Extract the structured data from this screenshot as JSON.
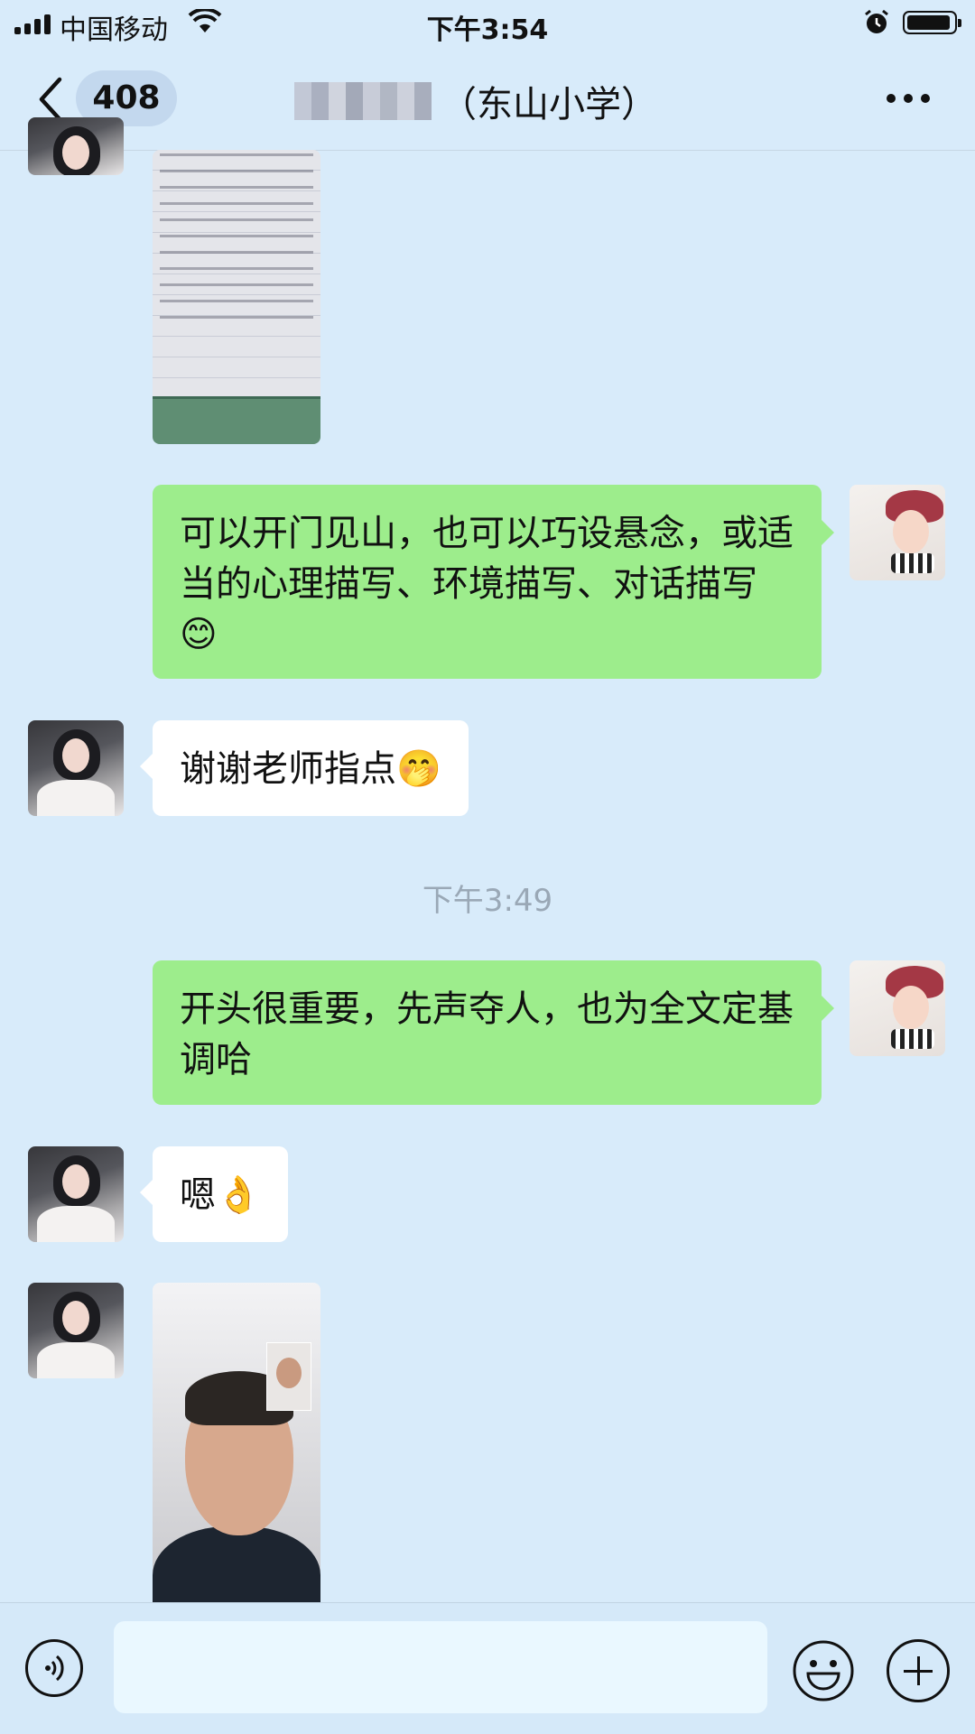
{
  "status_bar": {
    "carrier": "中国移动",
    "time": "下午3:54",
    "icons": [
      "signal-icon",
      "wifi-icon",
      "alarm-icon",
      "battery-icon"
    ]
  },
  "nav": {
    "unread_count": "408",
    "title": "（东山小学）",
    "icons": [
      "back-arrow-icon",
      "more-icon"
    ]
  },
  "messages": [
    {
      "type": "image",
      "sender": "other",
      "description_icon": "handwritten-note-image"
    },
    {
      "type": "text",
      "sender": "me",
      "text": "可以开门见山，也可以巧设悬念，或适当的心理描写、环境描写、对话描写😊"
    },
    {
      "type": "text",
      "sender": "other",
      "text": "谢谢老师指点🤭"
    },
    {
      "type": "text",
      "sender": "me",
      "text": "开头很重要，先声夺人，也为全文定基调哈"
    },
    {
      "type": "text",
      "sender": "other",
      "text": "嗯👌"
    },
    {
      "type": "image",
      "sender": "other",
      "description_icon": "video-call-image"
    }
  ],
  "timestamp": "下午3:49",
  "input_bar": {
    "placeholder": "",
    "icons": [
      "voice-icon",
      "emoji-icon",
      "plus-icon"
    ]
  },
  "colors": {
    "background": "#d8ebfa",
    "my_bubble": "#9ded8c",
    "their_bubble": "#ffffff",
    "timestamp": "#9aa8b6"
  }
}
